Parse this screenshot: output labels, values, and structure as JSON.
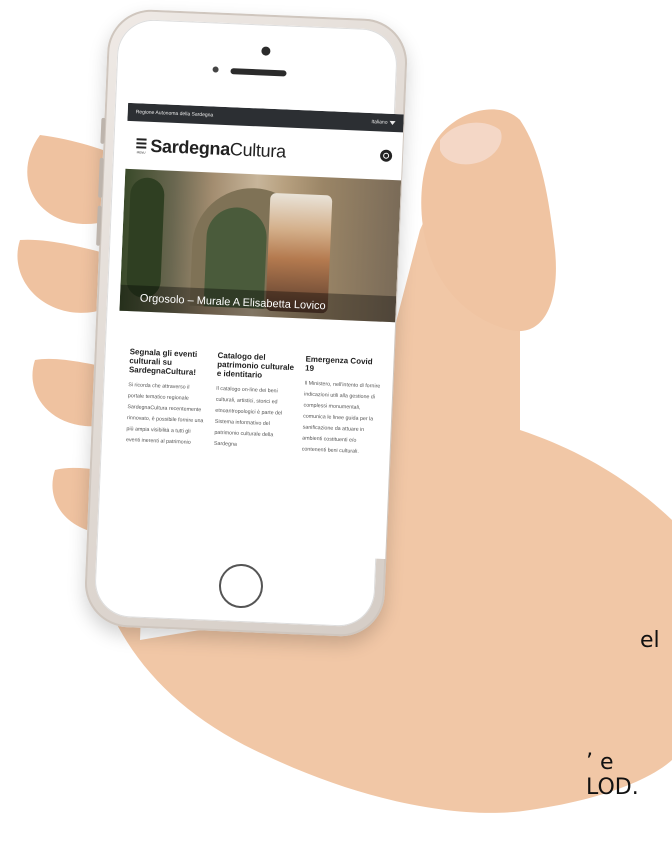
{
  "background": {
    "text_right_1": "el",
    "text_right_2": "’ e LOD."
  },
  "phone": {
    "site": {
      "topbar": {
        "left_label": "Regione Autonoma della Sardegna",
        "language": "Italiano"
      },
      "header": {
        "menu_label": "MENU",
        "brand_bold": "Sardegna",
        "brand_regular": "Cultura"
      },
      "hero": {
        "caption": "Orgosolo – Murale A Elisabetta Lovico"
      },
      "cards": [
        {
          "title": "Segnala gli eventi culturali su SardegnaCultura!",
          "text": "Si ricorda che attraverso il portale tematico regionale SardegnaCultura recentemente rinnovato, è possibile fornire una più ampia visibilità a tutti gli eventi inerenti al patrimonio"
        },
        {
          "title": "Catalogo del patrimonio culturale e identitario",
          "text": "Il catalogo on-line dei beni culturali, artistici, storici ed etnoantropologici è parte del Sistema informativo del patrimonio culturale della Sardegna"
        },
        {
          "title": "Emergenza Covid 19",
          "text": "Il Ministero, nell'intento di fornire indicazioni utili alla gestione di complessi monumentali, comunica le linee guida per la sanificazione da attuare in ambienti costituenti e/o contenenti beni culturali."
        }
      ]
    }
  },
  "colors": {
    "topbar": "#2c2f33",
    "skin": "#f1c7a6",
    "phone_body": "#e3dcd6"
  }
}
